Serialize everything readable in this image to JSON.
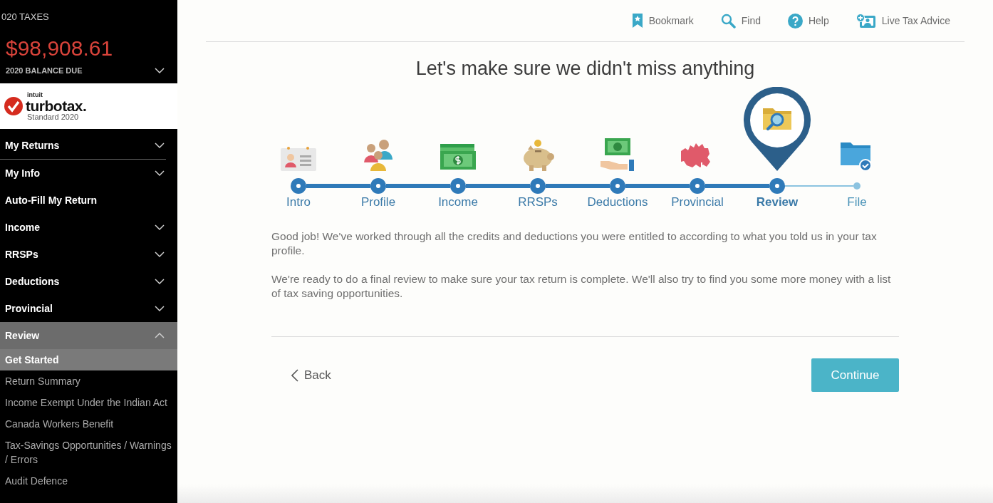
{
  "sidebar": {
    "header": {
      "title": "020 TAXES",
      "amount": "$98,908.61",
      "amount_label": "2020 BALANCE DUE",
      "expanded": false
    },
    "logo": {
      "small": "intuit",
      "brand": "turbotax",
      "dot": ".",
      "edition": "Standard 2020"
    },
    "items": [
      {
        "label": "My Returns",
        "expanded": false
      },
      {
        "label": "My Info",
        "expanded": false
      },
      {
        "label": "Auto-Fill My Return"
      },
      {
        "label": "Income",
        "expanded": false
      },
      {
        "label": "RRSPs",
        "expanded": false
      },
      {
        "label": "Deductions",
        "expanded": false
      },
      {
        "label": "Provincial",
        "expanded": false
      },
      {
        "label": "Review",
        "expanded": true,
        "children": [
          {
            "label": "Get Started",
            "selected": true
          },
          {
            "label": "Return Summary",
            "selected": false
          },
          {
            "label": "Income Exempt Under the Indian Act",
            "selected": false
          },
          {
            "label": "Canada Workers Benefit",
            "selected": false
          },
          {
            "label": "Tax-Savings Opportunities / Warnings / Errors",
            "selected": false
          },
          {
            "label": "Audit Defence",
            "selected": false
          }
        ]
      }
    ]
  },
  "toolbar": [
    {
      "kind": "bookmark",
      "label": "Bookmark"
    },
    {
      "kind": "find",
      "label": "Find"
    },
    {
      "kind": "help",
      "label": "Help"
    },
    {
      "kind": "advice",
      "label": "Live Tax Advice"
    }
  ],
  "title": "Let's make sure we didn't miss anything",
  "steps": [
    {
      "kind": "intro",
      "label": "Intro",
      "completed": true,
      "selected": false
    },
    {
      "kind": "profile",
      "label": "Profile",
      "completed": true,
      "selected": false
    },
    {
      "kind": "income",
      "label": "Income",
      "completed": true,
      "selected": false
    },
    {
      "kind": "rrsps",
      "label": "RRSPs",
      "completed": true,
      "selected": false
    },
    {
      "kind": "deductions",
      "label": "Deductions",
      "completed": true,
      "selected": false
    },
    {
      "kind": "provincial",
      "label": "Provincial",
      "completed": true,
      "selected": false
    },
    {
      "kind": "review",
      "label": "Review",
      "completed": false,
      "selected": true
    },
    {
      "kind": "file",
      "label": "File",
      "completed": false,
      "selected": false
    }
  ],
  "paragraphs": [
    "Good job! We've worked through all the credits and deductions you were entitled to according to what you told us in your tax profile.",
    "We're ready to do a final review to make sure your tax return is complete. We'll also try to find you some more money with a list of tax saving opportunities."
  ],
  "back": {
    "label": "Back"
  },
  "continue": {
    "label": "Continue"
  }
}
